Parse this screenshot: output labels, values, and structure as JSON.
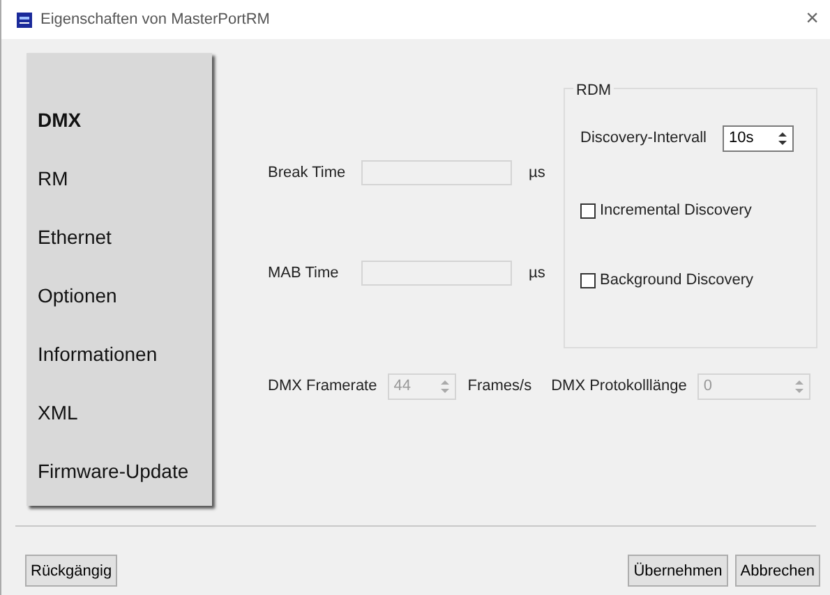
{
  "window": {
    "title": "Eigenschaften von MasterPortRM",
    "close": "×"
  },
  "sidebar": {
    "items": [
      {
        "label": "DMX",
        "selected": true
      },
      {
        "label": "RM",
        "selected": false
      },
      {
        "label": "Ethernet",
        "selected": false
      },
      {
        "label": "Optionen",
        "selected": false
      },
      {
        "label": "Informationen",
        "selected": false
      },
      {
        "label": "XML",
        "selected": false
      },
      {
        "label": "Firmware-Update",
        "selected": false
      }
    ]
  },
  "timings": [
    {
      "label": "Break Time",
      "unit": "µs",
      "disabled": true
    },
    {
      "label": "MAB Time",
      "unit": "µs",
      "disabled": true
    }
  ],
  "rdm": {
    "title": "RDM",
    "interval_label": "Discovery-Intervall",
    "interval_value": "10s",
    "options": [
      {
        "label": "Incremental Discovery",
        "checked": false
      },
      {
        "label": "Background Discovery",
        "checked": false
      }
    ]
  },
  "framerate": {
    "label": "DMX Framerate",
    "value": "44",
    "unit": "Frames/s",
    "disabled": true
  },
  "protocol_length": {
    "label": "DMX Protokolllänge",
    "value": "0",
    "disabled": true
  },
  "buttons": {
    "left": [
      "Rückgängig"
    ],
    "right": [
      "Übernehmen",
      "Abbrechen"
    ]
  }
}
